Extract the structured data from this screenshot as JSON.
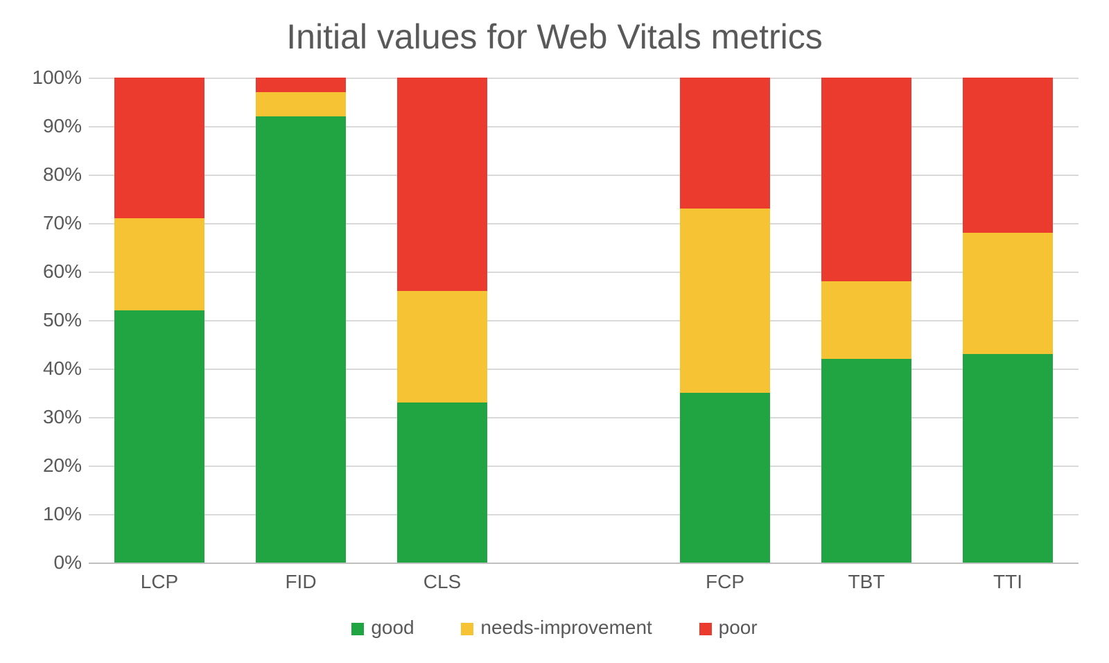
{
  "chart_data": {
    "type": "bar",
    "title": "Initial values for Web Vitals metrics",
    "xlabel": "",
    "ylabel": "",
    "ylim": [
      0,
      100
    ],
    "yticks": [
      "0%",
      "10%",
      "20%",
      "30%",
      "40%",
      "50%",
      "60%",
      "70%",
      "80%",
      "90%",
      "100%"
    ],
    "categories": [
      "LCP",
      "FID",
      "CLS",
      "",
      "FCP",
      "TBT",
      "TTI"
    ],
    "series": [
      {
        "name": "good",
        "color": "#21a442",
        "values": [
          52,
          92,
          33,
          null,
          35,
          42,
          43
        ]
      },
      {
        "name": "needs-improvement",
        "color": "#f6c334",
        "values": [
          19,
          5,
          23,
          null,
          38,
          16,
          25
        ]
      },
      {
        "name": "poor",
        "color": "#ea3b2e",
        "values": [
          29,
          3,
          44,
          null,
          27,
          42,
          32
        ]
      }
    ],
    "legend": [
      "good",
      "needs-improvement",
      "poor"
    ]
  }
}
